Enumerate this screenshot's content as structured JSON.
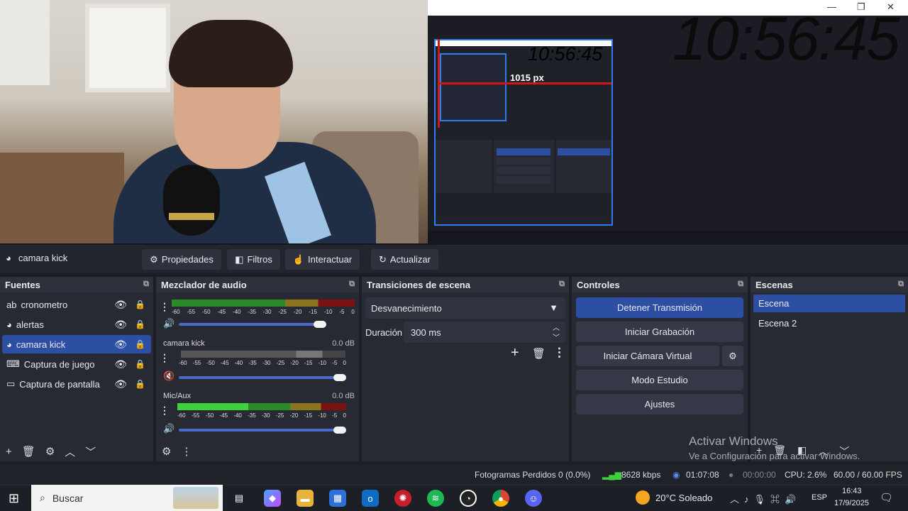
{
  "preview": {
    "big_clock": "10:56:45",
    "nested_clock": "10:56:45",
    "measure_label": "1015 px",
    "window_controls": {
      "minimize": "—",
      "restore": "❐",
      "close": "✕"
    }
  },
  "source_toolbar": {
    "selected_source": "camara kick",
    "buttons": [
      "Propiedades",
      "Filtros",
      "Interactuar",
      "Actualizar"
    ]
  },
  "sources": {
    "title": "Fuentes",
    "items": [
      {
        "label": "cronometro",
        "icon": "ab"
      },
      {
        "label": "alertas",
        "icon": "◕"
      },
      {
        "label": "camara kick",
        "icon": "◕"
      },
      {
        "label": "Captura de juego",
        "icon": "⌨"
      },
      {
        "label": "Captura de pantalla",
        "icon": "▭"
      }
    ]
  },
  "mixer": {
    "title": "Mezclador de audio",
    "scale": [
      "-60",
      "-55",
      "-50",
      "-45",
      "-40",
      "-35",
      "-30",
      "-25",
      "-20",
      "-15",
      "-10",
      "-5",
      "0"
    ],
    "channels": [
      {
        "name": "camara kick",
        "db": "0.0 dB"
      },
      {
        "name": "Mic/Aux",
        "db": "0.0 dB"
      }
    ]
  },
  "transitions": {
    "title": "Transiciones de escena",
    "selected": "Desvanecimiento",
    "duration_label": "Duración",
    "duration_value": "300 ms"
  },
  "controls": {
    "title": "Controles",
    "buttons": [
      "Detener Transmisión",
      "Iniciar Grabación",
      "Iniciar Cámara Virtual",
      "Modo Estudio",
      "Ajustes"
    ]
  },
  "scenes": {
    "title": "Escenas",
    "items": [
      "Escena",
      "Escena 2"
    ]
  },
  "watermark": {
    "line1": "Activar Windows",
    "line2": "Ve a Configuración para activar Windows."
  },
  "status": {
    "dropped": "Fotogramas Perdidos 0 (0.0%)",
    "kbps": "8628 kbps",
    "stream_time": "01:07:08",
    "rec_time": "00:00:00",
    "cpu": "CPU: 2.6%",
    "fps": "60.00 / 60.00 FPS"
  },
  "taskbar": {
    "search_placeholder": "Buscar",
    "weather": "20°C  Soleado",
    "lang": "ESP",
    "time": "16:43",
    "date": "17/9/2025"
  },
  "colors": {
    "accent": "#2c4fa3",
    "meter_green": "#3fcf3f",
    "meter_yellow": "#c9a82a",
    "meter_red": "#a01818"
  }
}
